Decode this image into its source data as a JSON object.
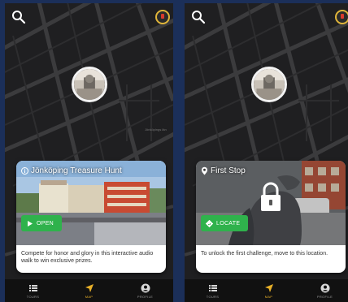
{
  "screens": [
    {
      "id": "left",
      "card": {
        "title": "Jönköping Treasure Hunt",
        "button_label": "OPEN",
        "button_icon": "play-icon",
        "description": "Compete for honor and glory in this interactive audio walk to win exclusive prizes."
      },
      "map_label": "Jönköpings län"
    },
    {
      "id": "right",
      "card": {
        "title": "First Stop",
        "title_icon": "map-pin-icon",
        "button_label": "LOCATE",
        "button_icon": "locate-icon",
        "description": "To unlock the first challenge, move to this location."
      }
    }
  ],
  "nav": {
    "items": [
      {
        "label": "TOURS",
        "icon": "list-icon"
      },
      {
        "label": "MAP",
        "icon": "navigation-arrow-icon",
        "active": true
      },
      {
        "label": "PROFILE",
        "icon": "profile-icon"
      }
    ]
  },
  "colors": {
    "background": "#1b2f59",
    "map": "#1f1f21",
    "accent_green": "#2fb24c",
    "active_nav": "#e8b028"
  }
}
